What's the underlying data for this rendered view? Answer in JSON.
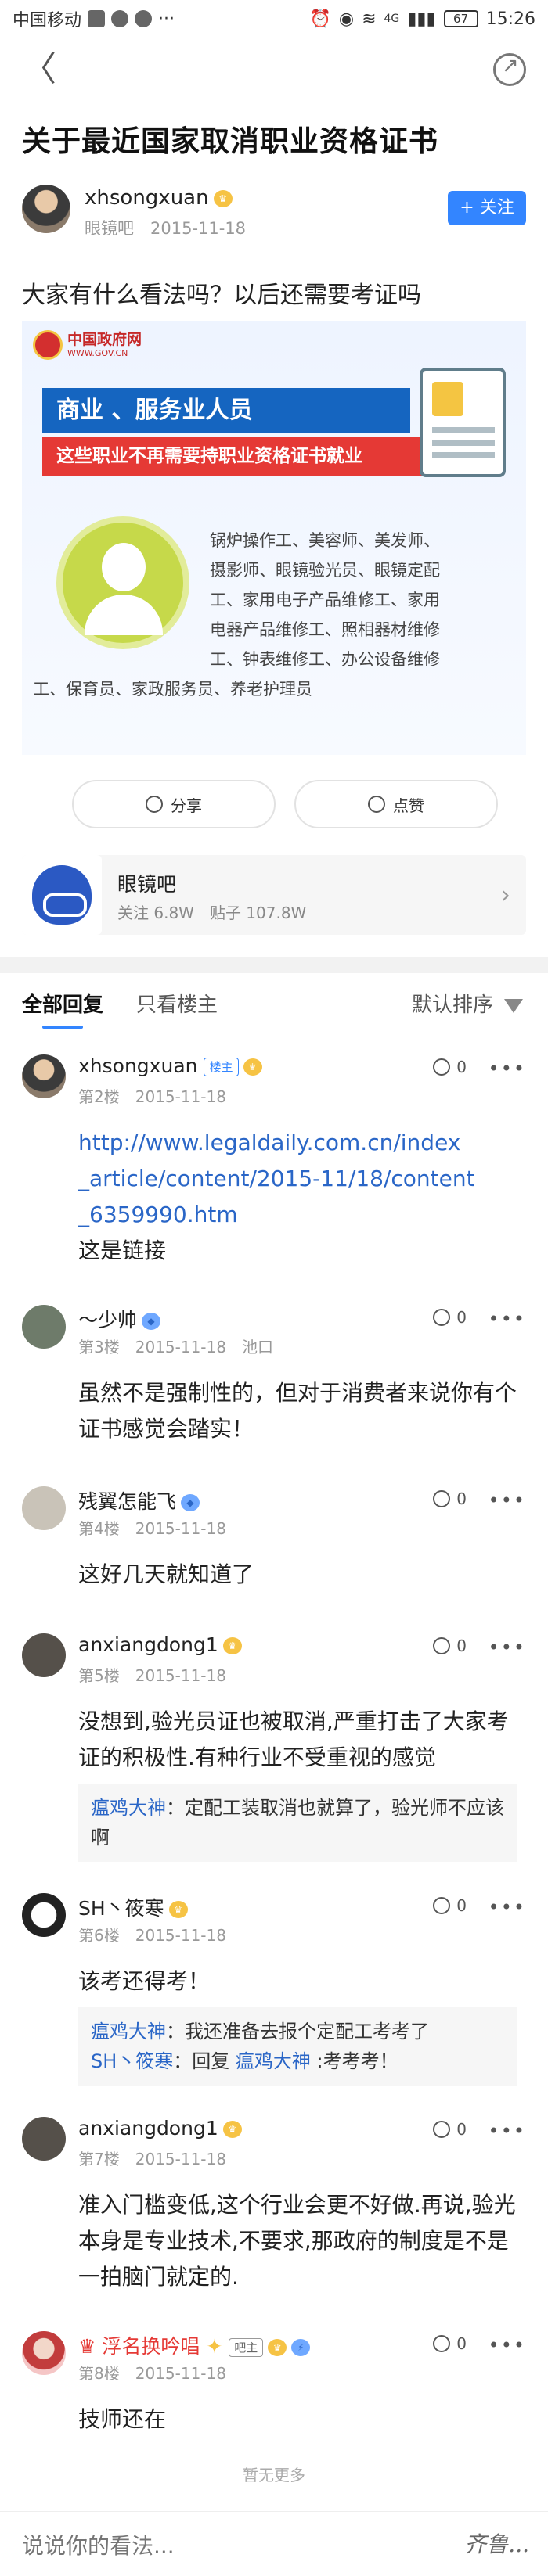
{
  "status_bar": {
    "carrier": "中国移动",
    "network": "4G",
    "battery": "67",
    "time": "15:26"
  },
  "post": {
    "title": "关于最近国家取消职业资格证书",
    "author": {
      "name": "xhsongxuan",
      "meta": "眼镜吧　2015-11-18"
    },
    "follow_label": "+ 关注",
    "text": "大家有什么看法吗？以后还需要考证吗",
    "banner": {
      "site_name": "中国政府网",
      "site_url": "WWW.GOV.CN",
      "headline": "商业 、服务业人员",
      "subheadline": "这些职业不再需要持职业资格证书就业",
      "jobs_lines": [
        "锅炉操作工、美容师、美发师、",
        "摄影师、眼镜验光员、眼镜定配",
        "工、家用电子产品维修工、家用",
        "电器产品维修工、照相器材维修",
        "工、钟表维修工、办公设备维修"
      ],
      "jobs_last": "工、保育员、家政服务员、养老护理员"
    },
    "share_label": "分享",
    "like_label": "点赞"
  },
  "forum": {
    "name": "眼镜吧",
    "stats": "关注 6.8W　贴子 107.8W"
  },
  "tabs": {
    "all": "全部回复",
    "op_only": "只看楼主",
    "sort": "默认排序"
  },
  "replies": [
    {
      "name": "xhsongxuan",
      "tag": "楼主",
      "meta": "第2楼　2015-11-18",
      "likes": "0",
      "body_lines": [
        "http://www.legaldaily.com.cn/index",
        "_article/content/2015-11/18/content",
        "_6359990.htm"
      ],
      "body_extra": "这是链接"
    },
    {
      "name": "～少帅",
      "meta": "第3楼　2015-11-18　池口",
      "likes": "0",
      "body": "虽然不是强制性的，但对于消费者来说你有个证书感觉会踏实！"
    },
    {
      "name": "残翼怎能飞",
      "meta": "第4楼　2015-11-18",
      "likes": "0",
      "body": "这好几天就知道了"
    },
    {
      "name": "anxiangdong1",
      "meta": "第5楼　2015-11-18",
      "likes": "0",
      "body": "没想到,验光员证也被取消,严重打击了大家考证的积极性.有种行业不受重视的感觉",
      "sub": [
        {
          "user": "瘟鸡大神",
          "text": "：定配工装取消也就算了，验光师不应该啊"
        }
      ]
    },
    {
      "name": "SH丶筱寒",
      "meta": "第6楼　2015-11-18",
      "likes": "0",
      "body": "该考还得考！",
      "sub": [
        {
          "user": "瘟鸡大神",
          "text": "：我还准备去报个定配工考考了"
        },
        {
          "user": "SH丶筱寒",
          "text": "：回复 ",
          "user2": "瘟鸡大神",
          "text2": " :考考考！"
        }
      ]
    },
    {
      "name": "anxiangdong1",
      "meta": "第7楼　2015-11-18",
      "likes": "0",
      "body": "准入门槛变低,这个行业会更不好做.再说,验光本身是专业技术,不要求,那政府的制度是不是一拍脑门就定的."
    },
    {
      "name": "浮名换吟唱",
      "tag": "吧主",
      "meta": "第8楼　2015-11-18",
      "likes": "0",
      "body": "技师还在"
    }
  ],
  "no_more": "暂无更多",
  "comment_placeholder": "说说你的看法...",
  "signature": "齐鲁...",
  "colors": {
    "accent": "#3385ff",
    "link": "#2a66c7"
  }
}
